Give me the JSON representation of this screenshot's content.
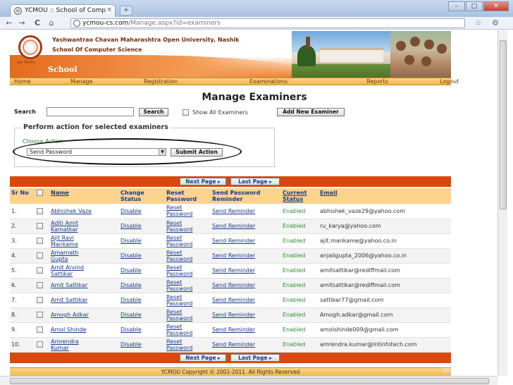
{
  "browser": {
    "tab_title": "YCMOU :: School of Comp",
    "tab_close": "×",
    "new_tab": "+",
    "url_host": "ycmou-cs.com",
    "url_path": "/Manage.aspx?id=examiners",
    "back": "←",
    "forward": "→",
    "reload": "C",
    "home": "⌂",
    "star": "☆",
    "wrench": "🔧"
  },
  "banner": {
    "university": "Yashwantrao Chavan Maharashtra Open University, Nashik",
    "school": "School Of Computer Science",
    "section": "School",
    "logo_caption": "मुक्त विद्यापीठ"
  },
  "menu": {
    "home": "Home",
    "manage": "Manage",
    "registration": "Registration",
    "examinations": "Examinations",
    "reports": "Reports",
    "logout": "Logout"
  },
  "page_title": "Manage Examiners",
  "search": {
    "label": "Search",
    "value": "",
    "button": "Search",
    "show_all": "Show All Examiners",
    "add_new": "Add New Examiner"
  },
  "action_panel": {
    "legend": "Perform action for selected examiners",
    "choose_label": "Choose Action",
    "selected": "Send Password",
    "submit": "Submit Action"
  },
  "pager": {
    "next": "Next Page ▸",
    "last": "Last Page ▸"
  },
  "grid": {
    "headers": {
      "sr": "Sr No",
      "name": "Name",
      "change_status": "Change Status",
      "reset_password": "Reset Password",
      "send_reminder": "Send Password Reminder",
      "current_status": "Current Status",
      "email": "Email"
    },
    "rows": [
      {
        "sr": "1.",
        "name": "Abhishek Vaze",
        "status_action": "Disable",
        "reset": "Reset Password",
        "reminder": "Send Reminder",
        "status": "Enabled",
        "email": "abhishek_vaze29@yahoo.com"
      },
      {
        "sr": "2.",
        "name": "Aditi Amit Kamatkar",
        "status_action": "Disable",
        "reset": "Reset Password",
        "reminder": "Send Reminder",
        "status": "Enabled",
        "email": "ru_karya@yahoo.com"
      },
      {
        "sr": "3.",
        "name": "Ajit Ravi Mankame",
        "status_action": "Disable",
        "reset": "Reset Password",
        "reminder": "Send Reminder",
        "status": "Enabled",
        "email": "ajit.mankame@yahoo.co.in"
      },
      {
        "sr": "4.",
        "name": "Amarnath Gupta",
        "status_action": "Disable",
        "reset": "Reset Password",
        "reminder": "Send Reminder",
        "status": "Enabled",
        "email": "anjaligupta_2006@yahoo.co.in"
      },
      {
        "sr": "5.",
        "name": "Amit Arvind Sattikar",
        "status_action": "Disable",
        "reset": "Reset Password",
        "reminder": "Send Reminder",
        "status": "Enabled",
        "email": "amitsattikar@rediffmail.com"
      },
      {
        "sr": "6.",
        "name": "Amit Sattikar",
        "status_action": "Disable",
        "reset": "Reset Password",
        "reminder": "Send Reminder",
        "status": "Enabled",
        "email": "amitsattikar@rediffmail.com"
      },
      {
        "sr": "7.",
        "name": "Amit Sattikar",
        "status_action": "Disable",
        "reset": "Reset Password",
        "reminder": "Send Reminder",
        "status": "Enabled",
        "email": "sattikar77@gmail.com"
      },
      {
        "sr": "8.",
        "name": "Amogh Adkar",
        "status_action": "Disable",
        "reset": "Reset Password",
        "reminder": "Send Reminder",
        "status": "Enabled",
        "email": "Amogh.adkar@gmail.com"
      },
      {
        "sr": "9.",
        "name": "Amol Shinde",
        "status_action": "Disable",
        "reset": "Reset Password",
        "reminder": "Send Reminder",
        "status": "Enabled",
        "email": "amolshinde009@gmail.com"
      },
      {
        "sr": "10.",
        "name": "Amrendra Kumar",
        "status_action": "Disable",
        "reset": "Reset Password",
        "reminder": "Send Reminder",
        "status": "Enabled",
        "email": "amrendra.kumar@lntinfotech.com"
      }
    ]
  },
  "footer": "YCMOU Copyright © 2001-2011. All Rights Reserved",
  "slide_number": "60",
  "colors": {
    "menu_bg": "#f0b64a",
    "grid_header_bg": "#fbd38c",
    "pager_bg": "#d9480f",
    "link": "#1a3a8a",
    "enabled": "#2f8f2f"
  }
}
